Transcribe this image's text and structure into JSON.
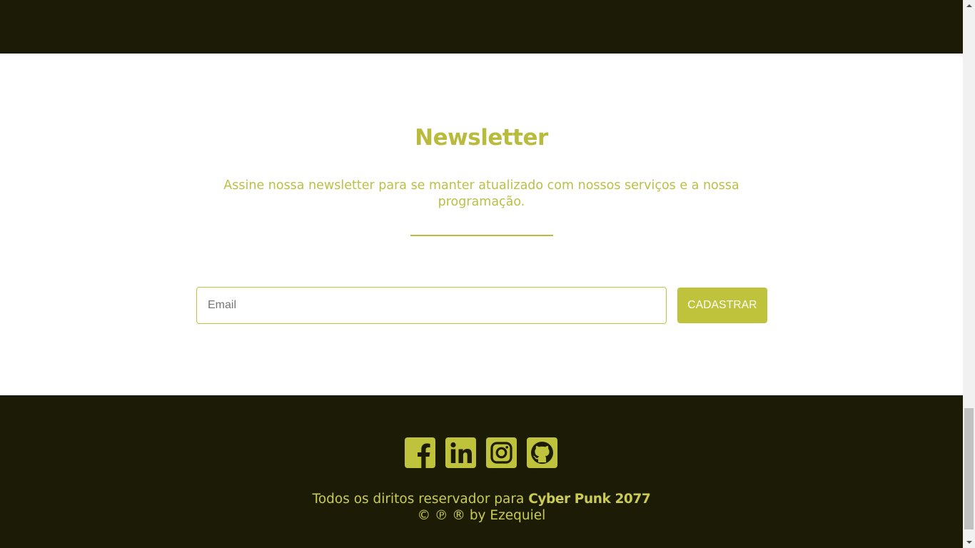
{
  "newsletter": {
    "title": "Newsletter",
    "description": "Assine nossa newsletter para se manter atualizado com nossos serviços e a nossa programação.",
    "email_placeholder": "Email",
    "submit_label": "CADASTRAR"
  },
  "footer": {
    "social_icons": [
      "facebook-icon",
      "linkedin-icon",
      "instagram-icon",
      "github-icon"
    ],
    "rights_text": "Todos os diritos reservador para ",
    "brand": "Cyber Punk 2077",
    "credit": "© ℗ ® by Ezequiel"
  },
  "colors": {
    "dark_background": "#1c1c06",
    "accent": "#bfc23b"
  }
}
